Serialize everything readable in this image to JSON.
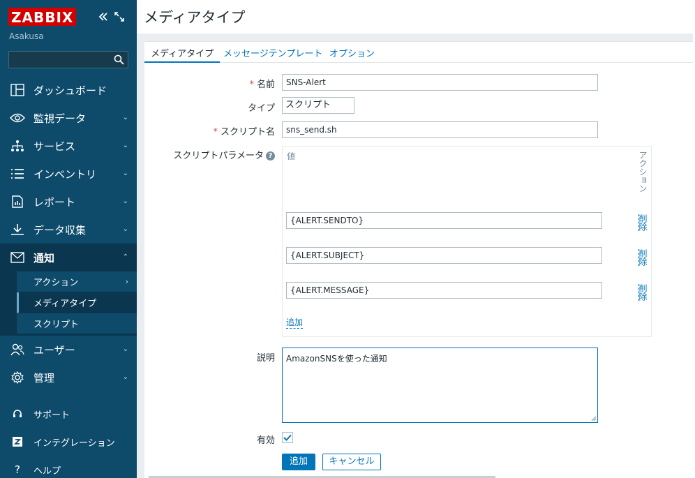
{
  "brand": {
    "logo": "ZABBIX",
    "hostname": "Asakusa"
  },
  "search": {
    "placeholder": ""
  },
  "nav": {
    "items": [
      {
        "label": "ダッシュボード",
        "icon": "dashboard-icon"
      },
      {
        "label": "監視データ",
        "icon": "eye-icon"
      },
      {
        "label": "サービス",
        "icon": "services-icon"
      },
      {
        "label": "インベントリ",
        "icon": "list-icon"
      },
      {
        "label": "レポート",
        "icon": "report-icon"
      },
      {
        "label": "データ収集",
        "icon": "download-icon"
      },
      {
        "label": "通知",
        "icon": "envelope-icon"
      },
      {
        "label": "ユーザー",
        "icon": "users-icon"
      },
      {
        "label": "管理",
        "icon": "gear-icon"
      }
    ],
    "sub": [
      "アクション",
      "メディアタイプ",
      "スクリプト"
    ],
    "bottom": [
      {
        "label": "サポート",
        "icon": "headset-icon"
      },
      {
        "label": "インテグレーション",
        "icon": "zabbix-z-icon"
      },
      {
        "label": "ヘルプ",
        "icon": "question-icon"
      }
    ]
  },
  "page": {
    "title": "メディアタイプ"
  },
  "tabs": [
    "メディアタイプ",
    "メッセージテンプレート",
    "オプション"
  ],
  "form": {
    "name_label": "名前",
    "name_value": "SNS-Alert",
    "type_label": "タイプ",
    "type_value": "スクリプト",
    "script_label": "スクリプト名",
    "script_value": "sns_send.sh",
    "params_label": "スクリプトパラメータ",
    "params_help": "?",
    "col_value": "値",
    "col_action": "アクション",
    "params": [
      "{ALERT.SENDTO}",
      "{ALERT.SUBJECT}",
      "{ALERT.MESSAGE}"
    ],
    "delete_label": "削除",
    "add_param": "追加",
    "desc_label": "説明",
    "desc_value": "AmazonSNSを使った通知",
    "enabled_label": "有効",
    "enabled": true,
    "required_mark": "*",
    "submit": "追加",
    "cancel": "キャンセル"
  },
  "colors": {
    "sidebar": "#0e4b6b",
    "accent": "#0275b8",
    "logo": "#d40000"
  }
}
